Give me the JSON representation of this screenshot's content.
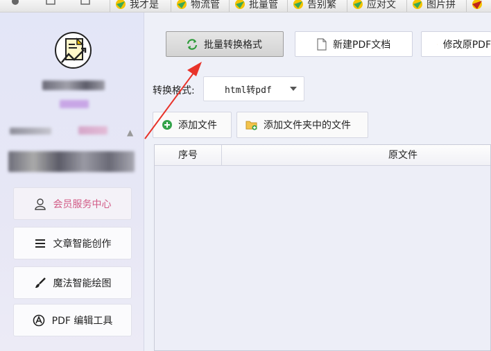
{
  "tabbar": {
    "tabs": [
      {
        "label": "我才是"
      },
      {
        "label": "物流管"
      },
      {
        "label": "批量管"
      },
      {
        "label": "告别繁"
      },
      {
        "label": "应对文"
      },
      {
        "label": "图片拼"
      }
    ]
  },
  "sidebar": {
    "items": [
      {
        "label": "会员服务中心",
        "icon": "user-icon"
      },
      {
        "label": "文章智能创作",
        "icon": "menu-lines-icon"
      },
      {
        "label": "魔法智能绘图",
        "icon": "brush-icon"
      },
      {
        "label": "PDF 编辑工具",
        "icon": "pdf-tool-icon"
      }
    ]
  },
  "toolbar": {
    "batch_convert": "批量转换格式",
    "new_pdf": "新建PDF文档",
    "modify": "修改原PDF"
  },
  "format": {
    "label": "转换格式:",
    "value": "html转pdf"
  },
  "actions": {
    "add_file": "添加文件",
    "add_folder": "添加文件夹中的文件"
  },
  "table": {
    "columns": [
      "序号",
      "原文件"
    ],
    "rows": []
  },
  "colors": {
    "annotation_arrow": "#e8332a",
    "vip_text": "#d25b86",
    "sidebar_bg": "#e3e6f7"
  }
}
